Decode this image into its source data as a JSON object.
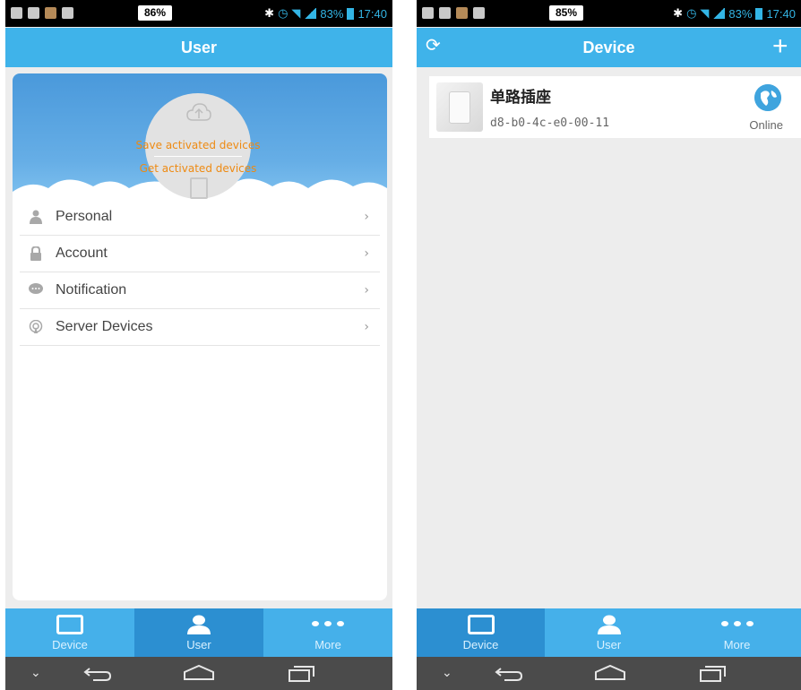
{
  "left_screen": {
    "status": {
      "battery_badge": "86%",
      "right_text": "83%",
      "time": "17:40"
    },
    "title": "User",
    "banner": {
      "save_label": "Save activated devices",
      "get_label": "Get activated devices"
    },
    "menu": [
      {
        "label": "Personal",
        "icon": "person-icon"
      },
      {
        "label": "Account",
        "icon": "lock-icon"
      },
      {
        "label": "Notification",
        "icon": "chat-bubble-icon"
      },
      {
        "label": "Server Devices",
        "icon": "broadcast-icon"
      }
    ],
    "tabs": [
      {
        "label": "Device",
        "active": false
      },
      {
        "label": "User",
        "active": true
      },
      {
        "label": "More",
        "active": false
      }
    ]
  },
  "right_screen": {
    "status": {
      "battery_badge": "85%",
      "right_text": "83%",
      "time": "17:40"
    },
    "title": "Device",
    "devices": [
      {
        "name": "单路插座",
        "mac": "d8-b0-4c-e0-00-11",
        "status": "Online"
      }
    ],
    "tabs": [
      {
        "label": "Device",
        "active": true
      },
      {
        "label": "User",
        "active": false
      },
      {
        "label": "More",
        "active": false
      }
    ]
  },
  "colors": {
    "accent": "#3fb3ea",
    "tab_active": "#2c8fd1",
    "banner_text": "#ee8a12",
    "navbar": "#4b4b4b"
  }
}
